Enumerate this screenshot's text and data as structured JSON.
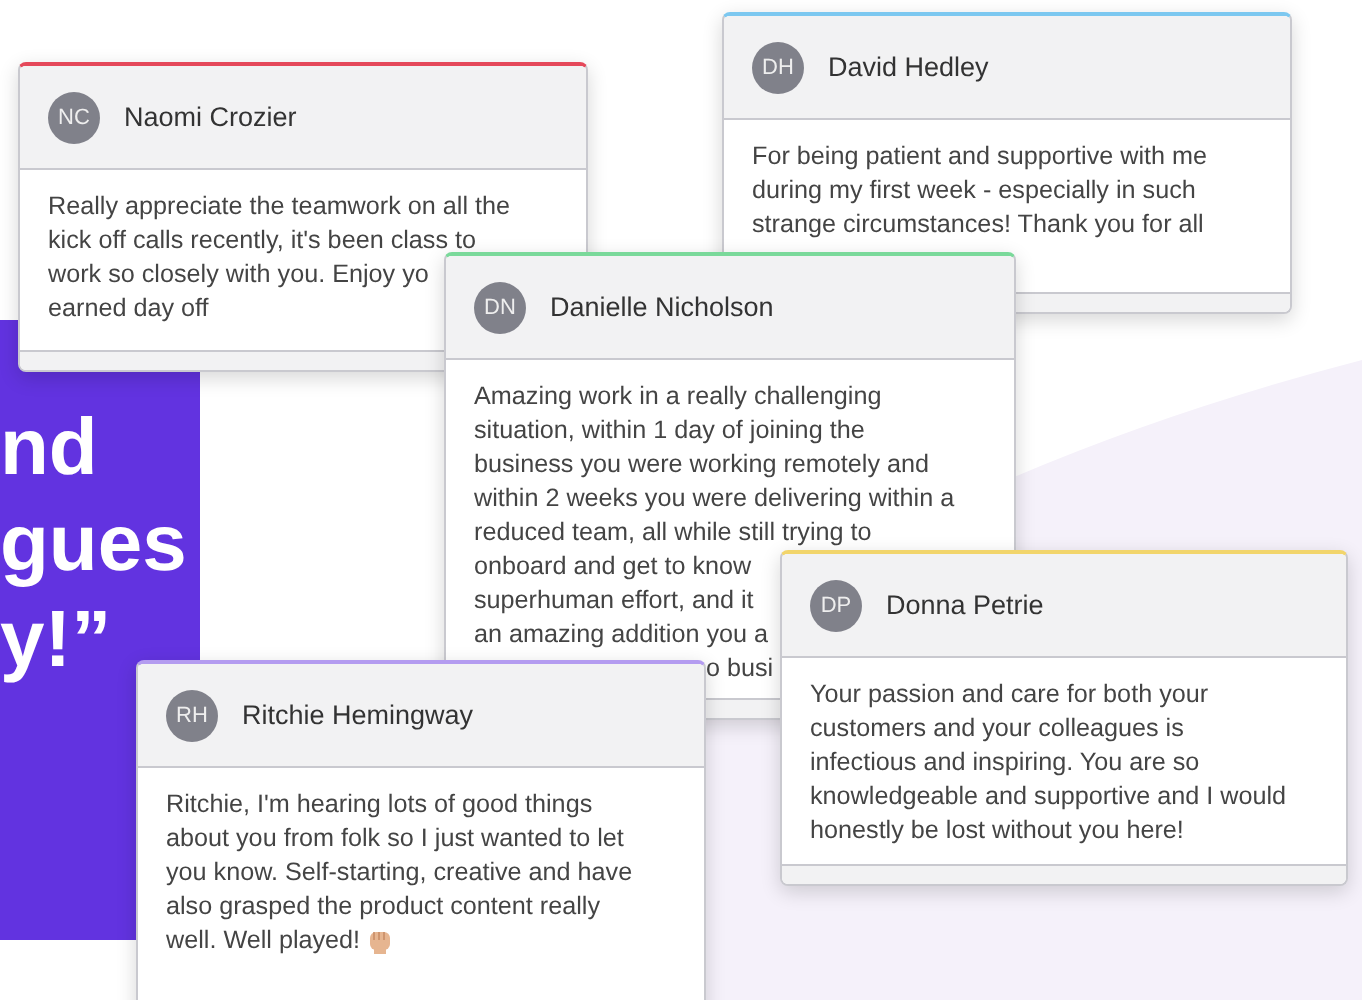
{
  "hero_text": {
    "lines": [
      "nd",
      "gues",
      "y!”"
    ]
  },
  "cards": [
    {
      "initials": "NC",
      "name": "Naomi Crozier",
      "color": "#e5485a",
      "message_lines": [
        {
          "kind": "line",
          "text": "Really appreciate the teamwork on all the"
        },
        {
          "kind": "line",
          "text": "kick off calls recently, it's been class to"
        },
        {
          "kind": "line",
          "text": "work so closely with you. Enjoy yo"
        },
        {
          "kind": "line",
          "text": "earned day off"
        }
      ]
    },
    {
      "initials": "DH",
      "name": "David Hedley",
      "color": "#7cc8f0",
      "message_lines": [
        {
          "kind": "line",
          "text": "For being patient and supportive with me"
        },
        {
          "kind": "line",
          "text": "during my first week - especially in such"
        },
        {
          "kind": "line",
          "text": "strange circumstances! Thank you for all"
        }
      ]
    },
    {
      "initials": "DN",
      "name": "Danielle Nicholson",
      "color": "#7ad99a",
      "message_lines": [
        {
          "kind": "line",
          "text": "Amazing work in a really challenging"
        },
        {
          "kind": "line",
          "text": "situation, within 1 day of joining the"
        },
        {
          "kind": "line",
          "text": "business you were working remotely and"
        },
        {
          "kind": "line",
          "text": "within 2 weeks you were delivering within a"
        },
        {
          "kind": "line",
          "text": "reduced team, all while still trying to"
        },
        {
          "kind": "line",
          "text": "onboard and get to know"
        },
        {
          "kind": "line",
          "text": "superhuman effort, and it"
        },
        {
          "kind": "line",
          "text": "an amazing addition you a"
        },
        {
          "kind": "fragment",
          "text": "o busi"
        }
      ]
    },
    {
      "initials": "RH",
      "name": "Ritchie Hemingway",
      "color": "#b49cf0",
      "message_lines": [
        {
          "kind": "line",
          "text": "Ritchie, I'm hearing lots of good things"
        },
        {
          "kind": "line",
          "text": "about you from folk so I just wanted to let"
        },
        {
          "kind": "line",
          "text": "you know. Self-starting, creative and have"
        },
        {
          "kind": "line",
          "text": "also grasped the product content really"
        },
        {
          "kind": "emoji_line",
          "text": "well. Well played!"
        }
      ]
    },
    {
      "initials": "DP",
      "name": "Donna Petrie",
      "color": "#f2d56b",
      "message_lines": [
        {
          "kind": "line",
          "text": "Your passion and care for both your"
        },
        {
          "kind": "line",
          "text": "customers and your colleagues is"
        },
        {
          "kind": "line",
          "text": "infectious and inspiring. You are so"
        },
        {
          "kind": "line",
          "text": "knowledgeable and supportive and I would"
        },
        {
          "kind": "line",
          "text": "honestly be lost without you here!"
        }
      ]
    }
  ]
}
